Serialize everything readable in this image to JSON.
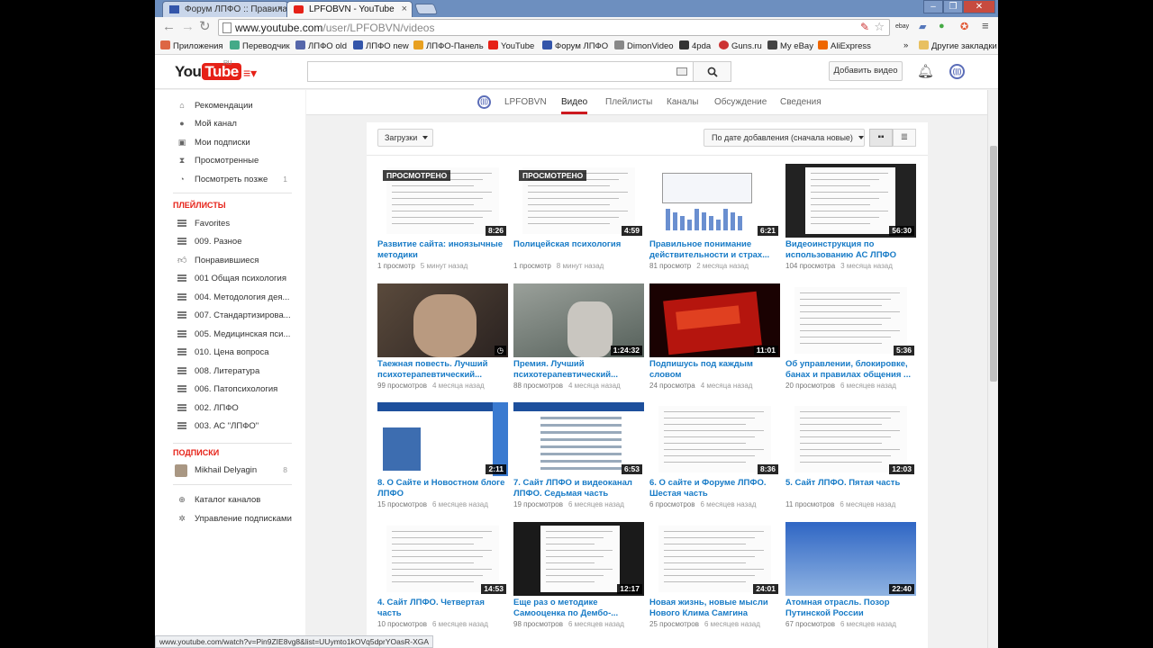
{
  "browser": {
    "tabs": [
      {
        "label": "Форум ЛПФО :: Правила"
      },
      {
        "label": "LPFOBVN - YouTube"
      }
    ],
    "url_main": "www.youtube.com",
    "url_rest": "/user/LPFOBVN/videos",
    "bookmarks": [
      {
        "label": "Приложения",
        "color": "#d64"
      },
      {
        "label": "Переводчик",
        "color": "#4a8"
      },
      {
        "label": "ЛПФО old",
        "color": "#5566aa"
      },
      {
        "label": "ЛПФО new",
        "color": "#3355aa"
      },
      {
        "label": "ЛПФО-Панель",
        "color": "#e8a020"
      },
      {
        "label": "YouTube",
        "color": "#e62117"
      },
      {
        "label": "Форум ЛПФО",
        "color": "#3355aa"
      },
      {
        "label": "DimonVideo",
        "color": "#888"
      },
      {
        "label": "4pda",
        "color": "#333"
      },
      {
        "label": "Guns.ru",
        "color": "#c33"
      },
      {
        "label": "My eBay",
        "color": "#444"
      },
      {
        "label": "AliExpress",
        "color": "#e60"
      },
      {
        "label": "»",
        "color": ""
      },
      {
        "label": "Другие закладки",
        "color": "#e8c060"
      }
    ]
  },
  "header": {
    "logo_you": "You",
    "logo_tube": "Tube",
    "logo_ru": "RU",
    "add_video_label": "Добавить видео"
  },
  "guide": {
    "main_items": [
      {
        "label": "Рекомендации",
        "icon": "home-icon",
        "glyph": "⌂"
      },
      {
        "label": "Мой канал",
        "icon": "user-icon",
        "glyph": "●"
      },
      {
        "label": "Мои подписки",
        "icon": "subscriptions-icon",
        "glyph": "▣"
      },
      {
        "label": "Просмотренные",
        "icon": "history-icon",
        "glyph": "⧗"
      },
      {
        "label": "Посмотреть позже",
        "icon": "clock-icon",
        "glyph": "◔",
        "count": "1"
      }
    ],
    "playlists_heading": "ПЛЕЙЛИСТЫ",
    "playlists": [
      {
        "label": "Favorites"
      },
      {
        "label": "009. Разное"
      },
      {
        "label": "Понравившиеся",
        "thumb": true
      },
      {
        "label": "001 Общая психология"
      },
      {
        "label": "004. Методология дея..."
      },
      {
        "label": "007. Стандартизирова..."
      },
      {
        "label": "005. Медицинская пси..."
      },
      {
        "label": "010. Цена вопроса"
      },
      {
        "label": "008. Литература"
      },
      {
        "label": "006. Патопсихология"
      },
      {
        "label": "002. ЛПФО"
      },
      {
        "label": "003. АС \"ЛПФО\""
      }
    ],
    "subs_heading": "ПОДПИСКИ",
    "subs": [
      {
        "label": "Mikhail Delyagin",
        "count": "8"
      }
    ],
    "footer_items": [
      {
        "label": "Каталог каналов",
        "icon": "catalog-icon",
        "glyph": "⊕"
      },
      {
        "label": "Управление подписками",
        "icon": "settings-gear-icon",
        "glyph": "✲"
      }
    ]
  },
  "channel_nav": {
    "channel_name": "LPFOBVN",
    "tabs": [
      "Видео",
      "Плейлисты",
      "Каналы",
      "Обсуждение",
      "Сведения"
    ],
    "channel_icon_text": "(||)"
  },
  "controls": {
    "uploads_label": "Загрузки",
    "sort_label": "По дате добавления (сначала новые)"
  },
  "videos": [
    {
      "title": "Развитие сайта: иноязычные методики",
      "views": "1 просмотр",
      "ago": "5 минут назад",
      "duration": "8:26",
      "watched": "ПРОСМОТРЕНО",
      "style": "doc"
    },
    {
      "title": "Полицейская психология",
      "views": "1 просмотр",
      "ago": "8 минут назад",
      "duration": "4:59",
      "watched": "ПРОСМОТРЕНО",
      "style": "doc"
    },
    {
      "title": "Правильное понимание действительности и страх...",
      "views": "81 просмотр",
      "ago": "2 месяца назад",
      "duration": "6:21",
      "style": "chart"
    },
    {
      "title": "Видеоинструкция по использованию АС ЛПФО",
      "views": "104 просмотра",
      "ago": "3 месяца назад",
      "duration": "56:30",
      "style": "docdark"
    },
    {
      "title": "Таежная повесть. Лучший психотерапевтический...",
      "views": "99 просмотров",
      "ago": "4 месяца назад",
      "duration": "",
      "clock": true,
      "style": "photo1"
    },
    {
      "title": "Премия. Лучший психотерапевтический...",
      "views": "88 просмотров",
      "ago": "4 месяца назад",
      "duration": "1:24:32",
      "style": "photo2"
    },
    {
      "title": "Подпишусь под каждым словом",
      "views": "24 просмотра",
      "ago": "4 месяца назад",
      "duration": "11:01",
      "style": "red"
    },
    {
      "title": "Об управлении, блокировке, банах и правилах общения ...",
      "views": "20 просмотров",
      "ago": "6 месяцев назад",
      "duration": "5:36",
      "style": "doc"
    },
    {
      "title": "8. О Сайте и Новостном блоге ЛПФО",
      "views": "15 просмотров",
      "ago": "6 месяцев назад",
      "duration": "2:11",
      "style": "site"
    },
    {
      "title": "7. Сайт ЛПФО и видеоканал ЛПФО. Седьмая часть",
      "views": "19 просмотров",
      "ago": "6 месяцев назад",
      "duration": "6:53",
      "style": "site2"
    },
    {
      "title": "6. О сайте и Форуме ЛПФО. Шестая часть",
      "views": "6 просмотров",
      "ago": "6 месяцев назад",
      "duration": "8:36",
      "style": "doc"
    },
    {
      "title": "5. Сайт ЛПФО. Пятая часть",
      "views": "11 просмотров",
      "ago": "6 месяцев назад",
      "duration": "12:03",
      "style": "doc"
    },
    {
      "title": "4. Сайт ЛПФО. Четвертая часть",
      "views": "10 просмотров",
      "ago": "6 месяцев назад",
      "duration": "14:53",
      "style": "doc"
    },
    {
      "title": "Еще раз о методике Самооценка по Дембо-...",
      "views": "98 просмотров",
      "ago": "6 месяцев назад",
      "duration": "12:17",
      "style": "docdark2"
    },
    {
      "title": "Новая жизнь, новые мысли Нового Клима Самгина",
      "views": "25 просмотров",
      "ago": "6 месяцев назад",
      "duration": "24:01",
      "style": "doc"
    },
    {
      "title": "Атомная отрасль. Позор Путинской России",
      "views": "67 просмотров",
      "ago": "6 месяцев назад",
      "duration": "22:40",
      "style": "blue"
    }
  ],
  "status_bar": "www.youtube.com/watch?v=Pin9ZIE8vg8&list=UUymto1kOVq5dprYOasR-XGA"
}
